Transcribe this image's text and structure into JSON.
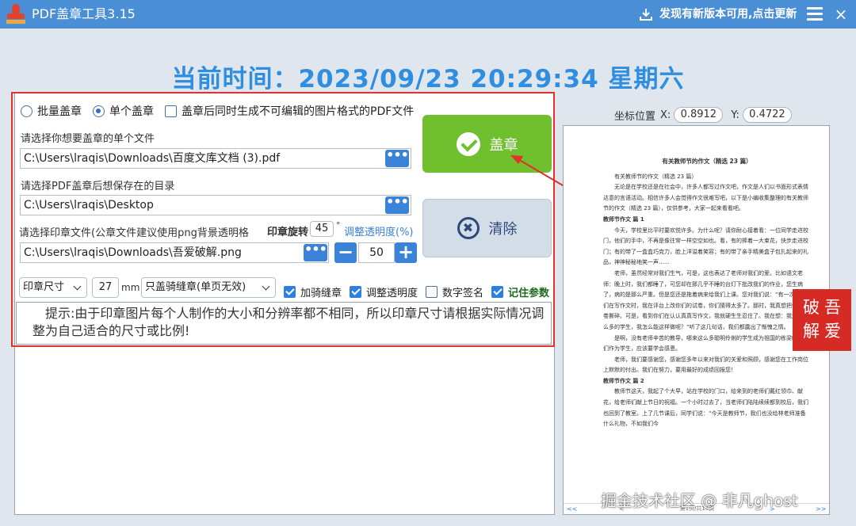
{
  "window": {
    "title": "PDF盖章工具3.15",
    "update_notice": "发现有新版本可用,点击更新",
    "close_glyph": "×"
  },
  "clock": {
    "text": "当前时间：2023/09/23 20:29:34  星期六"
  },
  "modes": {
    "batch_label": "批量盖章",
    "single_label": "单个盖章",
    "single_selected": true,
    "image_pdf_label": "盖章后同时生成不可编辑的图片格式的PDF文件",
    "image_pdf_checked": false
  },
  "file": {
    "label": "请选择你想要盖章的单个文件",
    "value": "C:\\Users\\lraqis\\Downloads\\百度文库文档 (3).pdf",
    "browse_glyph": "•••"
  },
  "save_dir": {
    "label": "请选择PDF盖章后想保存在的目录",
    "value": "C:\\Users\\lraqis\\Desktop",
    "browse_glyph": "•••"
  },
  "stamp_file": {
    "label": "请选择印章文件(公章文件建议使用png背景透明格",
    "value": "C:\\Users\\lraqis\\Downloads\\吾爱破解.png",
    "browse_glyph": "•••"
  },
  "rotation": {
    "label": "印章旋转",
    "value": "45",
    "unit": "°"
  },
  "opacity": {
    "link_label": "调整透明度(%)",
    "value": "50",
    "minus_glyph": "−",
    "plus_glyph": "+"
  },
  "actions": {
    "stamp_label": "盖章",
    "clear_label": "清除",
    "clear_glyph": "✖"
  },
  "size": {
    "select_label": "印章尺寸",
    "value": "27",
    "unit": "mm",
    "mode_select": "只盖骑缝章(单页无效)"
  },
  "options": {
    "seam_label": "加骑缝章",
    "seam_checked": true,
    "adjust_opacity_label": "调整透明度",
    "adjust_opacity_checked": true,
    "digital_sig_label": "数字签名",
    "digital_sig_checked": false,
    "remember_label": "记住参数",
    "remember_checked": true
  },
  "tip": {
    "text": "提示:由于印章图片每个人制作的大小和分辨率都不相同，所以印章尺寸请根据实际情况调整为自己适合的尺寸或比例!"
  },
  "coords": {
    "label": "坐标位置",
    "x_label": "X:",
    "x_value": "0.8912",
    "y_label": "Y:",
    "y_value": "0.4722"
  },
  "preview": {
    "doc_title": "有关教师节的作文（精选 23 篇）",
    "paragraphs": [
      "有关教师节的作文（精选 23 篇）",
      "无论是在学校还是在社会中，许多人都写过作文吧，作文是人们以书面形式表情达意的言语活动。相信许多人会觉得作文很难写吧，以下是小编收集整理的有关教师节的作文（精选 23 篇），仅供参考，大家一起来看看吧。"
    ],
    "heading1": "教师节作文 篇 1",
    "paragraphs2": [
      "今天，学校里比平时要欢悦许多。为什么呢？请你耐心接着看：一位同学走进校门，他们的手中，不再是像往常一样空空如也。看，有的捧着一大束花，快步走进校门；有的带了一盒盒巧克力，脸上洋溢着笑容；有的带了亲手精美盒子包扎起来的礼品，神神秘秘地笑一声……",
      "老师，虽然经常对我们生气，可是，这也表达了老师对我们的爱。比如语文老师：晚上时，我们都睡了，可您却在那几乎不睡的台灯下批改我们的作业，您生病了，病的是那么严重。但是您还是拖着病来给我们上课。您对我们说：“有一次，你们在写作文时，我在评台上改你们的试卷，你们猜得太多了。那时，我真想把你们都卷撕碎。可是，看到你们在认认真真写作文，我就硬生生忍住了。我在想：我还有这么多的学生，我怎么能这样做呢？”听了这几句话，我们都露出了惭愧之情。",
      "是啊，没有老师辛苦的教导，哪来这么多聪明伶俐的学生成为祖国的栋梁呢？我们作为学生，应该要学会感恩。",
      "老师，我们要感谢您，感谢您多年以来对我们的关爱和照顾，感谢您在工作岗位上默默的付出。我们在努力，要用最好的成绩回报您！"
    ],
    "heading2": "教师节作文 篇 2",
    "paragraphs3": [
      "教师节这天，我起了个大早，站在学校的门口，给来到的老师们戴红领巾、献花，给老师们献上节日的祝福。一个小时过去了，当老师们陆陆续续都到校后，我们也回到了教室。上了几节课后，同学们说：“今天是教师节，我们也没给林老师准备什么礼物，不如我们今"
    ],
    "pager_text": "第1页/共14页",
    "pager_first": "<<",
    "pager_prev": "<",
    "pager_next": ">",
    "pager_last": ">>"
  },
  "seal_stamp": {
    "text": "破吾解爱"
  },
  "watermark": {
    "text": "掘金技术社区 @ 非凡ghost"
  },
  "colors": {
    "titlebar": "#4a8fd6",
    "clock": "#2f8ee0",
    "stamp_button": "#6fbf2e",
    "accent_blue": "#3b83d8",
    "highlight_red": "#e0312b"
  }
}
